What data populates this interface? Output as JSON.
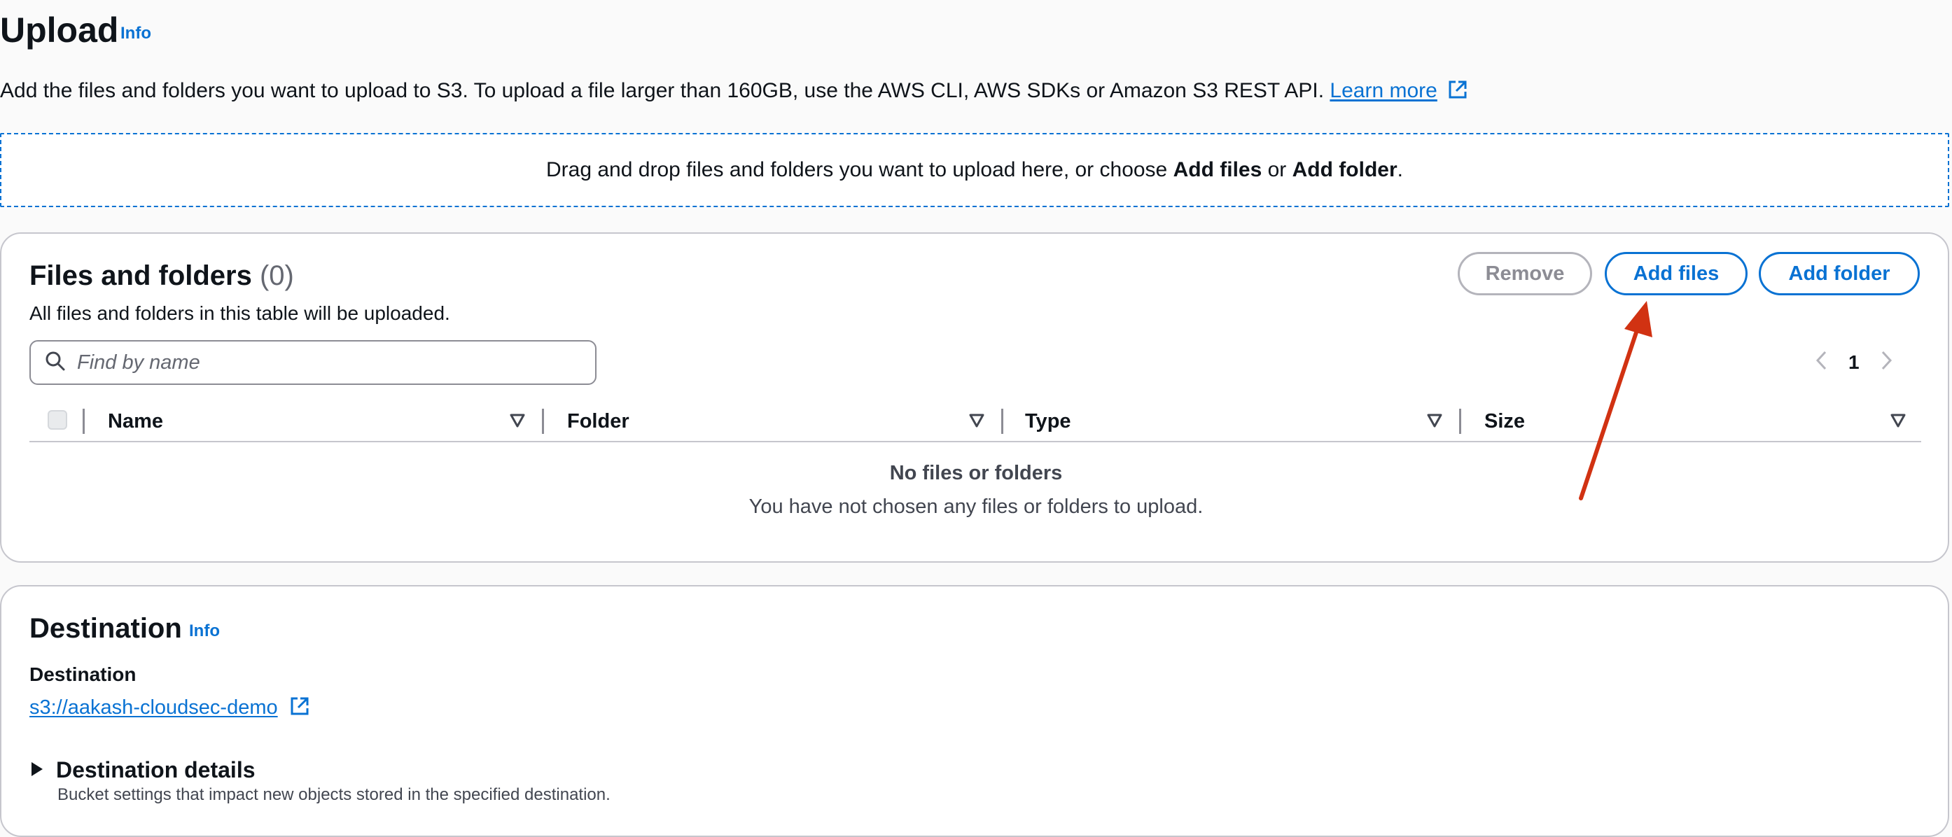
{
  "header": {
    "title": "Upload",
    "info_label": "Info",
    "intro_text": "Add the files and folders you want to upload to S3. To upload a file larger than 160GB, use the AWS CLI, AWS SDKs or Amazon S3 REST API.",
    "learn_more": "Learn more"
  },
  "dropzone": {
    "text_before": "Drag and drop files and folders you want to upload here, or choose ",
    "add_files": "Add files",
    "or": " or ",
    "add_folder": "Add folder",
    "period": "."
  },
  "files_panel": {
    "title": "Files and folders",
    "count": "(0)",
    "description": "All files and folders in this table will be uploaded.",
    "remove_label": "Remove",
    "add_files_label": "Add files",
    "add_folder_label": "Add folder",
    "search_placeholder": "Find by name",
    "page_number": "1",
    "columns": [
      "Name",
      "Folder",
      "Type",
      "Size"
    ],
    "empty_title": "No files or folders",
    "empty_description": "You have not chosen any files or folders to upload."
  },
  "destination": {
    "title": "Destination",
    "info_label": "Info",
    "field_label": "Destination",
    "bucket_uri": "s3://aakash-cloudsec-demo",
    "details_title": "Destination details",
    "details_description": "Bucket settings that impact new objects stored in the specified destination."
  },
  "colors": {
    "accent": "#0972d3",
    "text": "#0f141a",
    "muted": "#656871",
    "border": "#c6c6cd",
    "annotation_arrow": "#d13212"
  },
  "icons": [
    "info-link",
    "external-link-icon",
    "search-icon",
    "chevron-left-icon",
    "chevron-right-icon",
    "sort-icon",
    "caret-right-icon",
    "annotation-arrow"
  ]
}
